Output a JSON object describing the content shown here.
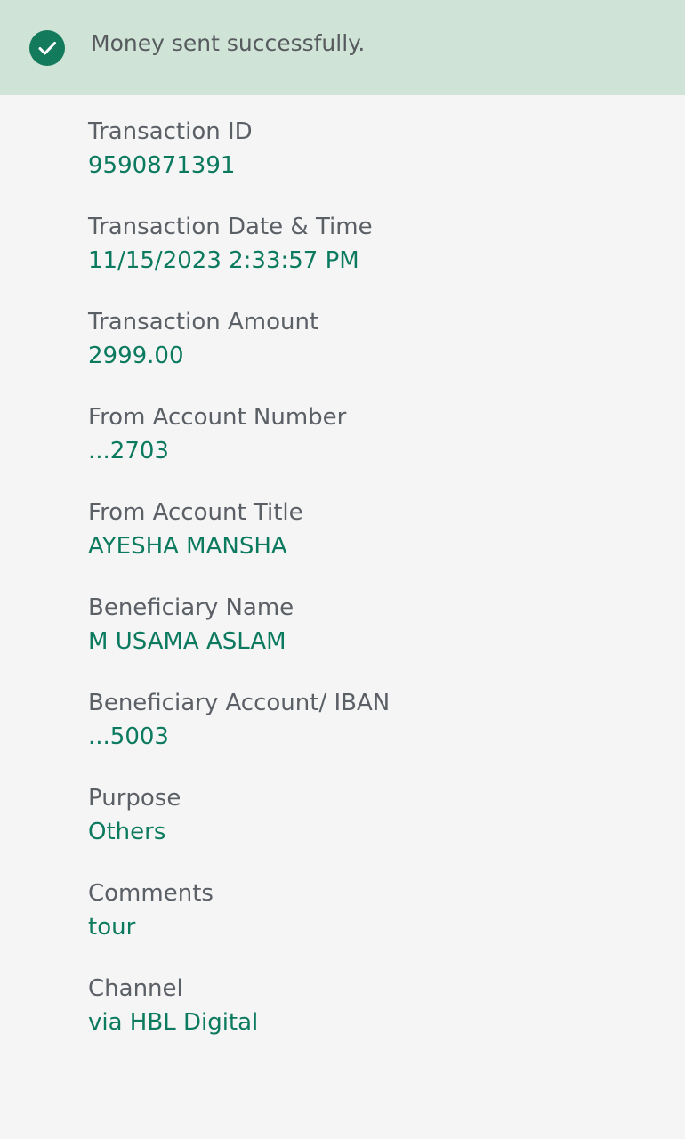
{
  "banner": {
    "icon": "check-circle-icon",
    "message": "Money sent successfully.",
    "accent_color": "#137a5b",
    "background_color": "#cfe3d6"
  },
  "details": [
    {
      "label": "Transaction ID",
      "value": "9590871391"
    },
    {
      "label": "Transaction Date & Time",
      "value": "11/15/2023 2:33:57 PM"
    },
    {
      "label": "Transaction Amount",
      "value": "2999.00"
    },
    {
      "label": "From Account Number",
      "value": "...2703"
    },
    {
      "label": "From Account Title",
      "value": "AYESHA MANSHA"
    },
    {
      "label": "Beneficiary Name",
      "value": "M USAMA ASLAM"
    },
    {
      "label": "Beneficiary Account/ IBAN",
      "value": "...5003"
    },
    {
      "label": "Purpose",
      "value": "Others"
    },
    {
      "label": "Comments",
      "value": "tour"
    },
    {
      "label": "Channel",
      "value": "via HBL Digital"
    }
  ],
  "colors": {
    "label": "#5b5f66",
    "value": "#0b7a5e"
  }
}
